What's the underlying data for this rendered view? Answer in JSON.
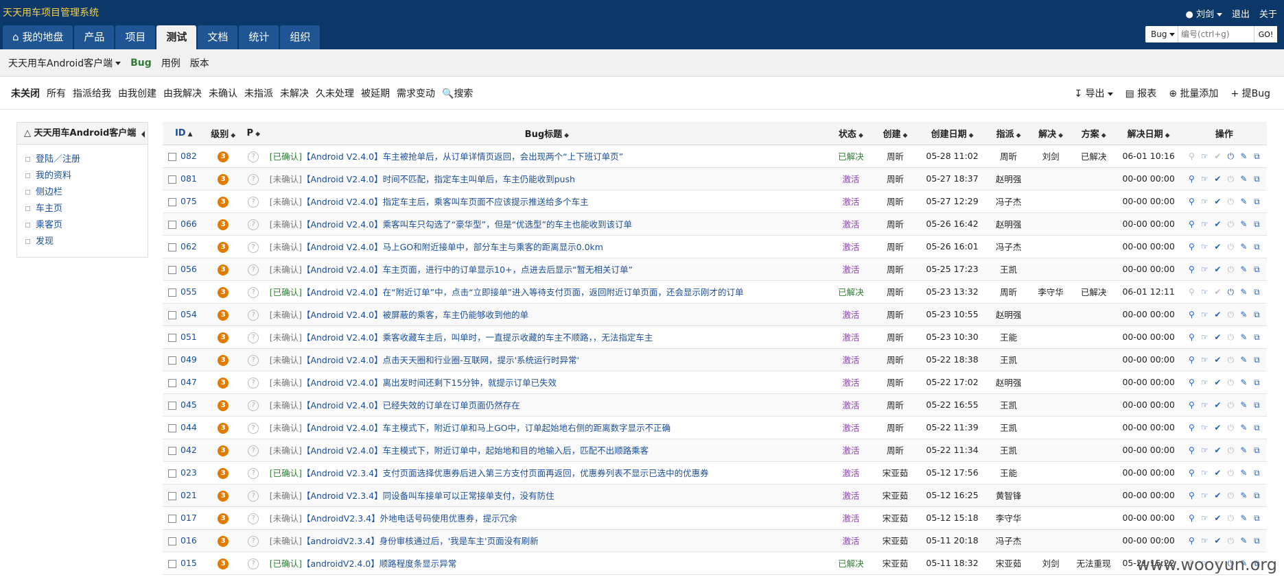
{
  "app": {
    "title": "天天用车项目管理系统"
  },
  "user_menu": {
    "user": "刘剑",
    "logout": "退出",
    "about": "关于"
  },
  "main_nav": [
    {
      "label": "我的地盘",
      "icon": "home-icon",
      "active": false
    },
    {
      "label": "产品",
      "active": false
    },
    {
      "label": "项目",
      "active": false
    },
    {
      "label": "测试",
      "active": true
    },
    {
      "label": "文档",
      "active": false
    },
    {
      "label": "统计",
      "active": false
    },
    {
      "label": "组织",
      "active": false
    }
  ],
  "quick_search": {
    "type": "Bug",
    "placeholder": "编号(ctrl+g)",
    "go": "GO!"
  },
  "subnav": {
    "product": "天天用车Android客户端",
    "items": [
      "Bug",
      "用例",
      "版本"
    ]
  },
  "filters": [
    "未关闭",
    "所有",
    "指派给我",
    "由我创建",
    "由我解决",
    "未确认",
    "未指派",
    "未解决",
    "久未处理",
    "被延期",
    "需求变动"
  ],
  "search_label": "搜索",
  "actions": {
    "export": "导出",
    "report": "报表",
    "batch_add": "批量添加",
    "add_bug": "提Bug"
  },
  "sidebar": {
    "title": "天天用车Android客户端",
    "items": [
      "登陆／注册",
      "我的资料",
      "侧边栏",
      "车主页",
      "乘客页",
      "发现"
    ]
  },
  "table": {
    "headers": [
      "ID",
      "级别",
      "P",
      "Bug标题",
      "状态",
      "创建",
      "创建日期",
      "指派",
      "解决",
      "方案",
      "解决日期",
      "操作"
    ],
    "rows": [
      {
        "id": "082",
        "sev": "3",
        "tag": "[已确认]",
        "confirmed": true,
        "title": "【Android V2.4.0】车主被抢单后，从订单详情页返回，会出现两个“上下班订单页”",
        "status": "已解决",
        "creator": "周昕",
        "date": "05-28 11:02",
        "assign": "周昕",
        "resolver": "刘剑",
        "solution": "已解决",
        "rdate": "06-01 10:16"
      },
      {
        "id": "081",
        "sev": "3",
        "tag": "[未确认]",
        "confirmed": false,
        "title": "【Android V2.4.0】时间不匹配，指定车主叫单后，车主仍能收到push",
        "status": "激活",
        "creator": "周昕",
        "date": "05-27 18:37",
        "assign": "赵明强",
        "resolver": "",
        "solution": "",
        "rdate": "00-00 00:00"
      },
      {
        "id": "075",
        "sev": "3",
        "tag": "[未确认]",
        "confirmed": false,
        "title": "【Android V2.4.0】指定车主后，乘客叫车页面不应该提示推送给多个车主",
        "status": "激活",
        "creator": "周昕",
        "date": "05-27 12:29",
        "assign": "冯子杰",
        "resolver": "",
        "solution": "",
        "rdate": "00-00 00:00"
      },
      {
        "id": "066",
        "sev": "3",
        "tag": "[未确认]",
        "confirmed": false,
        "title": "【Android V2.4.0】乘客叫车只勾选了“豪华型”，但是“优选型”的车主也能收到该订单",
        "status": "激活",
        "creator": "周昕",
        "date": "05-26 16:42",
        "assign": "赵明强",
        "resolver": "",
        "solution": "",
        "rdate": "00-00 00:00"
      },
      {
        "id": "062",
        "sev": "3",
        "tag": "[未确认]",
        "confirmed": false,
        "title": "【Android V2.4.0】马上GO和附近接单中，部分车主与乘客的距离显示0.0km",
        "status": "激活",
        "creator": "周昕",
        "date": "05-26 16:01",
        "assign": "冯子杰",
        "resolver": "",
        "solution": "",
        "rdate": "00-00 00:00"
      },
      {
        "id": "056",
        "sev": "3",
        "tag": "[未确认]",
        "confirmed": false,
        "title": "【Android V2.4.0】车主页面，进行中的订单显示10+，点进去后显示“暂无相关订单”",
        "status": "激活",
        "creator": "周昕",
        "date": "05-25 17:23",
        "assign": "王凯",
        "resolver": "",
        "solution": "",
        "rdate": "00-00 00:00"
      },
      {
        "id": "055",
        "sev": "3",
        "tag": "[已确认]",
        "confirmed": true,
        "title": "【Android V2.4.0】在“附近订单”中，点击“立即接单”进入等待支付页面，返回附近订单页面，还会显示刚才的订单",
        "status": "已解决",
        "creator": "周昕",
        "date": "05-23 13:32",
        "assign": "周昕",
        "resolver": "李守华",
        "solution": "已解决",
        "rdate": "06-01 12:11"
      },
      {
        "id": "054",
        "sev": "3",
        "tag": "[未确认]",
        "confirmed": false,
        "title": "【Android V2.4.0】被屏蔽的乘客，车主仍能够收到他的单",
        "status": "激活",
        "creator": "周昕",
        "date": "05-23 10:55",
        "assign": "赵明强",
        "resolver": "",
        "solution": "",
        "rdate": "00-00 00:00"
      },
      {
        "id": "051",
        "sev": "3",
        "tag": "[未确认]",
        "confirmed": false,
        "title": "【Android V2.4.0】乘客收藏车主后，叫单时，一直提示收藏的车主不顺路，，无法指定车主",
        "status": "激活",
        "creator": "周昕",
        "date": "05-23 10:30",
        "assign": "王能",
        "resolver": "",
        "solution": "",
        "rdate": "00-00 00:00"
      },
      {
        "id": "049",
        "sev": "3",
        "tag": "[未确认]",
        "confirmed": false,
        "title": "【Android V2.4.0】点击天天圈和行业圈-互联网，提示'系统运行时异常'",
        "status": "激活",
        "creator": "周昕",
        "date": "05-22 18:38",
        "assign": "王凯",
        "resolver": "",
        "solution": "",
        "rdate": "00-00 00:00"
      },
      {
        "id": "047",
        "sev": "3",
        "tag": "[未确认]",
        "confirmed": false,
        "title": "【Android V2.4.0】离出发时间还剩下15分钟，就提示订单已失效",
        "status": "激活",
        "creator": "周昕",
        "date": "05-22 17:02",
        "assign": "赵明强",
        "resolver": "",
        "solution": "",
        "rdate": "00-00 00:00"
      },
      {
        "id": "045",
        "sev": "3",
        "tag": "[未确认]",
        "confirmed": false,
        "title": "【Android V2.4.0】已经失效的订单在订单页面仍然存在",
        "status": "激活",
        "creator": "周昕",
        "date": "05-22 16:55",
        "assign": "王凯",
        "resolver": "",
        "solution": "",
        "rdate": "00-00 00:00"
      },
      {
        "id": "044",
        "sev": "3",
        "tag": "[未确认]",
        "confirmed": false,
        "title": "【Android V2.4.0】车主模式下，附近订单和马上GO中，订单起始地右侧的距离数字显示不正确",
        "status": "激活",
        "creator": "周昕",
        "date": "05-22 11:39",
        "assign": "王凯",
        "resolver": "",
        "solution": "",
        "rdate": "00-00 00:00"
      },
      {
        "id": "042",
        "sev": "3",
        "tag": "[未确认]",
        "confirmed": false,
        "title": "【Android V2.4.0】车主模式下，附近订单中，起始地和目的地输入后，匹配不出顺路乘客",
        "status": "激活",
        "creator": "周昕",
        "date": "05-22 11:34",
        "assign": "王凯",
        "resolver": "",
        "solution": "",
        "rdate": "00-00 00:00"
      },
      {
        "id": "023",
        "sev": "3",
        "tag": "[已确认]",
        "confirmed": true,
        "title": "【Android V2.3.4】支付页面选择优惠券后进入第三方支付页面再返回，优惠券列表不显示已选中的优惠券",
        "status": "激活",
        "creator": "宋亚茹",
        "date": "05-12 17:56",
        "assign": "王能",
        "resolver": "",
        "solution": "",
        "rdate": "00-00 00:00"
      },
      {
        "id": "021",
        "sev": "3",
        "tag": "[未确认]",
        "confirmed": false,
        "title": "【Android V2.3.4】同设备叫车接单可以正常接单支付，没有防住",
        "status": "激活",
        "creator": "宋亚茹",
        "date": "05-12 16:25",
        "assign": "黄智锋",
        "resolver": "",
        "solution": "",
        "rdate": "00-00 00:00"
      },
      {
        "id": "017",
        "sev": "3",
        "tag": "[未确认]",
        "confirmed": false,
        "title": "【AndroidV2.3.4】外地电话号码使用优惠券，提示冗余",
        "status": "激活",
        "creator": "宋亚茹",
        "date": "05-12 15:18",
        "assign": "李守华",
        "resolver": "",
        "solution": "",
        "rdate": "00-00 00:00"
      },
      {
        "id": "016",
        "sev": "3",
        "tag": "[未确认]",
        "confirmed": false,
        "title": "【androidV2.3.4】身份审核通过后，'我是车主'页面没有刷新",
        "status": "激活",
        "creator": "宋亚茹",
        "date": "05-11 20:18",
        "assign": "冯子杰",
        "resolver": "",
        "solution": "",
        "rdate": "00-00 00:00"
      },
      {
        "id": "015",
        "sev": "3",
        "tag": "[已确认]",
        "confirmed": true,
        "title": "【androidV2.4.0】顺路程度条显示异常",
        "status": "已解决",
        "creator": "宋亚茹",
        "date": "05-11 18:32",
        "assign": "宋亚茹",
        "resolver": "刘剑",
        "solution": "无法重现",
        "rdate": "05-21 15:22"
      }
    ]
  },
  "watermark": "www.wooyun.org"
}
